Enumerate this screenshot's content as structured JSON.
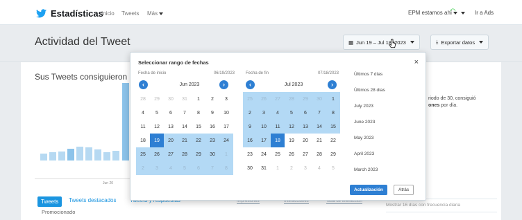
{
  "nav": {
    "brand": "Estadísticas",
    "links": [
      "Inicio",
      "Tweets",
      "Más"
    ],
    "account": "EPM estamos ahí",
    "right_link": "Ir a Ads"
  },
  "header": {
    "title": "Actividad del Tweet",
    "date_range": "Jun 19 – Jul 18, 2023",
    "export_label": "Exportar datos"
  },
  "summary": {
    "text": "Sus Tweets consiguieron",
    "side_lines": [
      "riodo de 30, consiguió",
      "ones por día."
    ],
    "side_strong": "ones"
  },
  "tabs": {
    "active": "Tweets",
    "others": [
      "Tweets destacados",
      "Tweets y respuestas"
    ],
    "promoted": "Promocionado",
    "columns": [
      "Impresiones",
      "Interacciones",
      "Tasa de interacción"
    ],
    "side_note": "Mostrar 16 días con frecuencia diaria"
  },
  "chart_axis_label": "Jun 20",
  "picker": {
    "title": "Seleccionar rango de fechas",
    "start": {
      "label": "Fecha de inicio",
      "value": "06/19/2023",
      "month": "Jun 2023",
      "days": [
        [
          "28",
          "29",
          "30",
          "31",
          "1",
          "2",
          "3"
        ],
        [
          "4",
          "5",
          "6",
          "7",
          "8",
          "9",
          "10"
        ],
        [
          "11",
          "12",
          "13",
          "14",
          "15",
          "16",
          "17"
        ],
        [
          "18",
          "19",
          "20",
          "21",
          "22",
          "23",
          "24"
        ],
        [
          "25",
          "26",
          "27",
          "28",
          "29",
          "30",
          "1"
        ],
        [
          "2",
          "3",
          "4",
          "5",
          "6",
          "7",
          "8"
        ]
      ]
    },
    "end": {
      "label": "Fecha de fin",
      "value": "07/18/2023",
      "month": "Jul 2023",
      "days": [
        [
          "25",
          "26",
          "27",
          "28",
          "29",
          "30",
          "1"
        ],
        [
          "2",
          "3",
          "4",
          "5",
          "6",
          "7",
          "8"
        ],
        [
          "9",
          "10",
          "11",
          "12",
          "13",
          "14",
          "15"
        ],
        [
          "16",
          "17",
          "18",
          "19",
          "20",
          "21",
          "22"
        ],
        [
          "23",
          "24",
          "25",
          "26",
          "27",
          "28",
          "29"
        ],
        [
          "30",
          "31",
          "1",
          "2",
          "3",
          "4",
          "5"
        ]
      ]
    },
    "presets": [
      "Últimos 7 días",
      "Últimos 28 días",
      "July 2023",
      "June 2023",
      "May 2023",
      "April 2023",
      "March 2023"
    ],
    "apply": "Actualización",
    "cancel": "Atrás",
    "close": "×"
  },
  "colors": {
    "accent": "#2e7fd3",
    "range_fill": "#b3d9f5",
    "tab_blue": "#1b95e0"
  }
}
